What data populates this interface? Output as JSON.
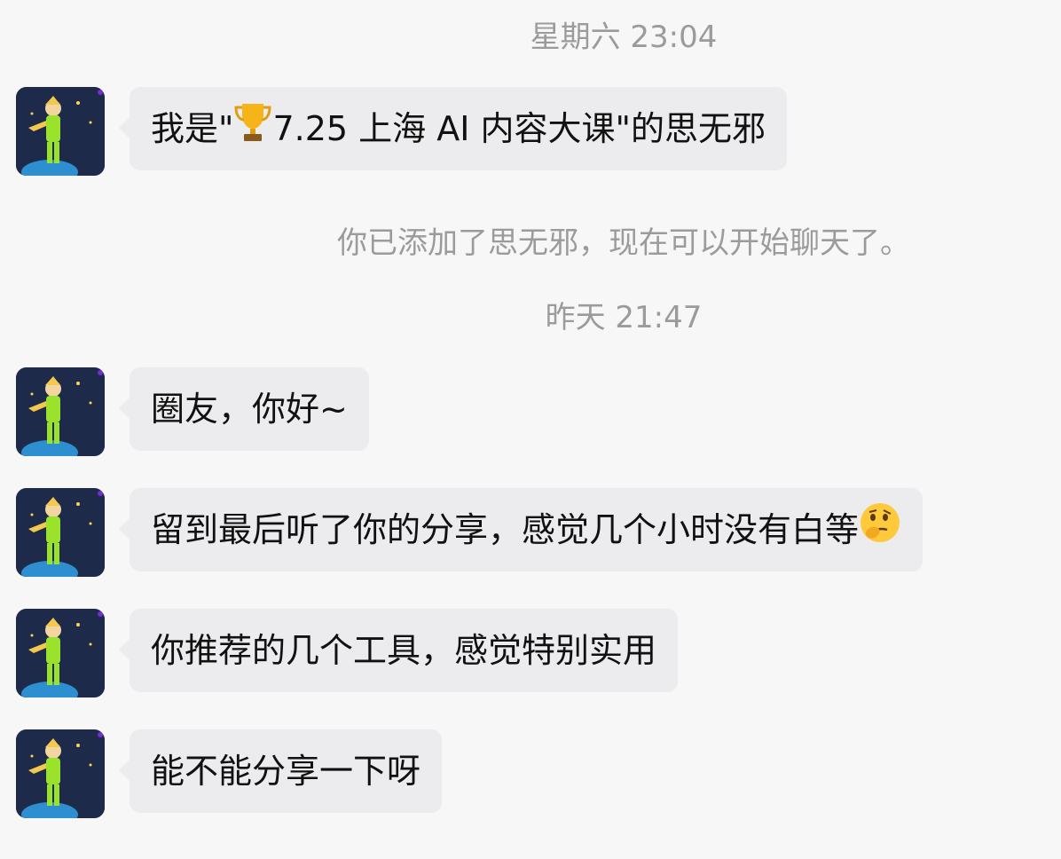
{
  "timestamps": {
    "first": "星期六 23:04",
    "second": "昨天 21:47"
  },
  "system_note": "你已添加了思无邪，现在可以开始聊天了。",
  "messages": [
    {
      "prefix": "我是\"",
      "emoji": "trophy-icon",
      "suffix": "7.25 上海 AI 内容大课\"的思无邪"
    },
    {
      "text": "圈友，你好~"
    },
    {
      "text": "留到最后听了你的分享，感觉几个小时没有白等",
      "emoji": "thinking-face-icon"
    },
    {
      "text": "你推荐的几个工具，感觉特别实用"
    },
    {
      "text": "能不能分享一下呀"
    }
  ],
  "colors": {
    "background": "#f7f7f8",
    "bubble": "#ececee",
    "meta_text": "#9b9b9b",
    "avatar_bg": "#1d2a4a",
    "avatar_figure": "#9be22d"
  }
}
